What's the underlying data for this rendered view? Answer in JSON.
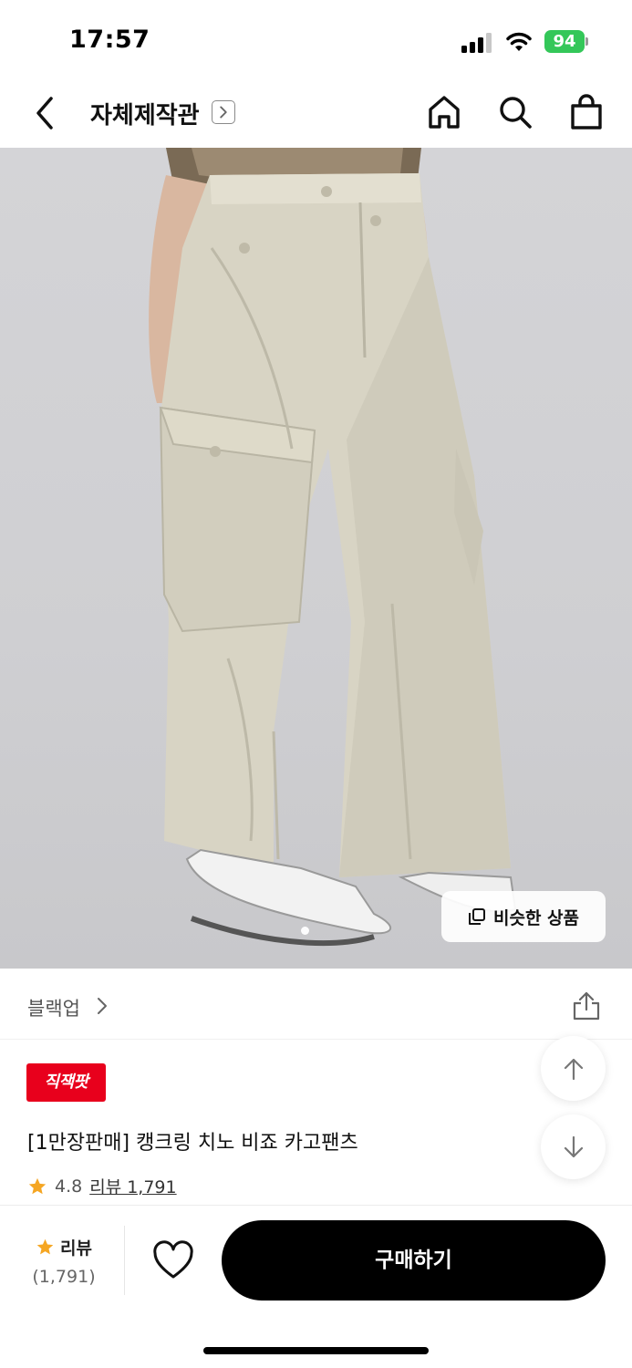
{
  "status_bar": {
    "time": "17:57",
    "battery": "94"
  },
  "header": {
    "store_title": "자체제작관"
  },
  "hero": {
    "similar_label": "비슷한 상품"
  },
  "brand": {
    "name": "블랙업"
  },
  "product": {
    "badge": "직잭팟",
    "name": "[1만장판매] 캥크링 치노 비죠 카고팬츠",
    "rating": "4.8",
    "review_link": "리뷰 1,791"
  },
  "bottom_bar": {
    "review_label": "리뷰",
    "review_count": "(1,791)",
    "buy_label": "구매하기"
  },
  "colors": {
    "accent": "#e8001c",
    "star": "#f5a623",
    "buy_button": "#000000",
    "battery": "#34c759"
  },
  "icons": [
    "back-icon",
    "store-arrow-icon",
    "home-icon",
    "search-icon",
    "cart-icon",
    "similar-icon",
    "chevron-right-icon",
    "share-icon",
    "star-icon",
    "arrow-up-icon",
    "arrow-down-icon",
    "heart-icon"
  ]
}
